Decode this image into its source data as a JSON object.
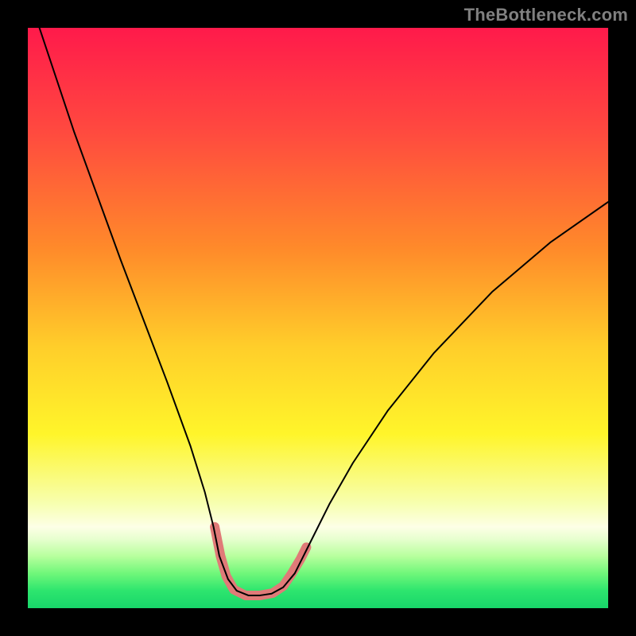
{
  "watermark": "TheBottleneck.com",
  "chart_data": {
    "type": "line",
    "title": "",
    "xlabel": "",
    "ylabel": "",
    "xlim": [
      0,
      100
    ],
    "ylim": [
      0,
      100
    ],
    "grid": false,
    "legend": false,
    "gradient_stops": [
      {
        "pct": 0,
        "color": "#ff1a4b"
      },
      {
        "pct": 18,
        "color": "#ff4a3f"
      },
      {
        "pct": 38,
        "color": "#ff8a2a"
      },
      {
        "pct": 55,
        "color": "#ffce2a"
      },
      {
        "pct": 70,
        "color": "#fff52a"
      },
      {
        "pct": 82,
        "color": "#f7ffb0"
      },
      {
        "pct": 86,
        "color": "#fdffe6"
      },
      {
        "pct": 88,
        "color": "#e8ffd0"
      },
      {
        "pct": 91,
        "color": "#b8ff9e"
      },
      {
        "pct": 94,
        "color": "#70f77a"
      },
      {
        "pct": 97,
        "color": "#2de56e"
      },
      {
        "pct": 100,
        "color": "#18d66a"
      }
    ],
    "series": [
      {
        "name": "bottleneck-curve",
        "color": "#000000",
        "width": 2.0,
        "x": [
          2,
          5,
          8,
          12,
          16,
          20,
          24,
          28,
          30.5,
          32,
          33,
          34.5,
          36,
          38,
          40,
          42,
          44,
          46,
          48,
          52,
          56,
          62,
          70,
          80,
          90,
          100
        ],
        "y": [
          100,
          91,
          82,
          71,
          60,
          49.5,
          39,
          28,
          20,
          14,
          9,
          5,
          3,
          2.2,
          2.2,
          2.5,
          3.6,
          6,
          10,
          18,
          25,
          34,
          44,
          54.5,
          63,
          70
        ]
      },
      {
        "name": "dip-marker",
        "type": "marker-band",
        "color": "#e07a78",
        "width": 12,
        "cap": "round",
        "x": [
          32.2,
          33.2,
          34.2,
          35.5,
          37.5,
          40,
          42.2,
          44,
          45.5,
          47,
          48
        ],
        "y": [
          14,
          9,
          5.5,
          3.2,
          2.2,
          2.2,
          2.6,
          3.8,
          6,
          8.5,
          10.5
        ]
      }
    ]
  }
}
